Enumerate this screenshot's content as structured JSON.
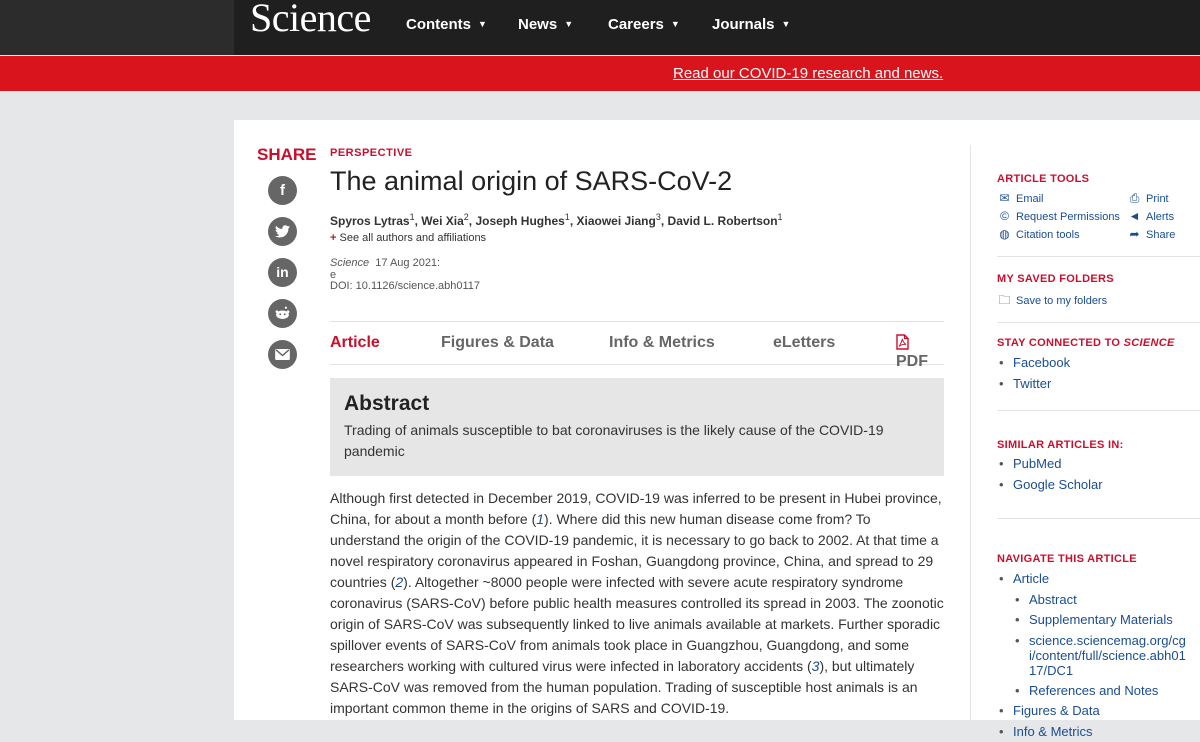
{
  "header": {
    "logo": "Science",
    "nav": [
      "Contents",
      "News",
      "Careers",
      "Journals"
    ],
    "banner_link": "Read our COVID-19 research and news."
  },
  "share": {
    "label": "SHARE",
    "icons": [
      "facebook-icon",
      "twitter-icon",
      "linkedin-icon",
      "reddit-icon",
      "email-icon"
    ]
  },
  "article": {
    "kicker": "PERSPECTIVE",
    "title": "The animal origin of SARS-CoV-2",
    "authors": [
      {
        "name": "Spyros Lytras",
        "aff": "1"
      },
      {
        "name": "Wei Xia",
        "aff": "2"
      },
      {
        "name": "Joseph Hughes",
        "aff": "1"
      },
      {
        "name": "Xiaowei Jiang",
        "aff": "3"
      },
      {
        "name": "David L. Robertson",
        "aff": "1"
      }
    ],
    "see_all": "See all authors and affiliations",
    "citation": {
      "journal": "Science",
      "date": "17 Aug 2021:",
      "line2": "e",
      "doi": "DOI: 10.1126/science.abh0117"
    },
    "tabs": [
      "Article",
      "Figures & Data",
      "Info & Metrics",
      "eLetters",
      "PDF"
    ],
    "abstract_heading": "Abstract",
    "abstract_text": "Trading of animals susceptible to bat coronaviruses is the likely cause of the COVID-19 pandemic",
    "body": [
      "Although first detected in December 2019, COVID-19 was inferred to be present in Hubei province, China, for about a month before (",
      "1",
      "). Where did this new human disease come from? To understand the origin of the COVID-19 pandemic, it is necessary to go back to 2002. At that time a novel respiratory coronavirus appeared in Foshan, Guangdong province, China, and spread to 29 countries (",
      "2",
      "). Altogether ~8000 people were infected with severe acute respiratory syndrome coronavirus (SARS-CoV) before public health measures controlled its spread in 2003. The zoonotic origin of SARS-CoV was subsequently linked to live animals available at markets. Further sporadic spillover events of SARS-CoV from animals took place in Guangzhou, Guangdong, and some researchers working with cultured virus were infected in laboratory accidents (",
      "3",
      "), but ultimately SARS-CoV was removed from the human population. Trading of susceptible host animals is an important common theme in the origins of SARS and COVID-19."
    ]
  },
  "sidebar": {
    "article_tools": {
      "heading": "ARTICLE TOOLS",
      "items": [
        "Email",
        "Print",
        "Request Permissions",
        "Alerts",
        "Citation tools",
        "Share"
      ]
    },
    "saved_folders": {
      "heading": "MY SAVED FOLDERS",
      "item": "Save to my folders"
    },
    "stay_connected": {
      "heading": "STAY CONNECTED TO ",
      "heading_journal": "SCIENCE",
      "items": [
        "Facebook",
        "Twitter"
      ]
    },
    "similar": {
      "heading": "SIMILAR ARTICLES IN:",
      "items": [
        "PubMed",
        "Google Scholar"
      ]
    },
    "navigate": {
      "heading": "NAVIGATE THIS ARTICLE",
      "items": [
        "Article",
        "Abstract",
        "Supplementary Materials",
        "science.sciencemag.org/cgi/content/full/science.abh0117/DC1",
        "References and Notes",
        "Figures & Data",
        "Info & Metrics"
      ]
    }
  },
  "colors": {
    "accent": "#c8102e",
    "banner": "#d9141c",
    "header": "#1f1f1f",
    "link": "#1a4d91"
  }
}
